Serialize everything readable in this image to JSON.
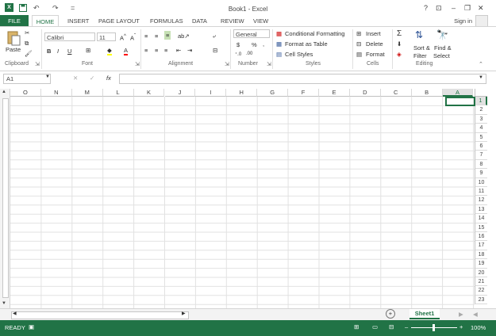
{
  "window": {
    "title": "Book1 - Excel"
  },
  "quick_access": {
    "undo": "↶",
    "redo": "↷",
    "customize": "="
  },
  "window_controls": {
    "help": "?",
    "ribbon_opts": "⊡",
    "minimize": "–",
    "restore": "❐",
    "close": "✕"
  },
  "tabs": [
    "FILE",
    "HOME",
    "INSERT",
    "PAGE LAYOUT",
    "FORMULAS",
    "DATA",
    "REVIEW",
    "VIEW"
  ],
  "account": {
    "signin": "Sign in"
  },
  "ribbon": {
    "clipboard": {
      "paste": "Paste",
      "label": "Clipboard"
    },
    "font": {
      "name": "Calibri",
      "size": "11",
      "label": "Font",
      "bold": "B",
      "italic": "I",
      "underline": "U"
    },
    "alignment": {
      "label": "Alignment"
    },
    "number": {
      "format": "General",
      "currency": "$",
      "percent": "%",
      "comma": ",",
      "label": "Number"
    },
    "styles": {
      "conditional": "Conditional Formatting",
      "table": "Format as Table",
      "cell_styles": "Cell Styles",
      "label": "Styles"
    },
    "cells": {
      "insert": "Insert",
      "delete": "Delete",
      "format": "Format",
      "label": "Cells"
    },
    "editing": {
      "sort": "Sort &",
      "sort2": "Filter",
      "find": "Find &",
      "find2": "Select",
      "label": "Editing"
    }
  },
  "formula_bar": {
    "name_box": "A1",
    "fx": "fx",
    "cancel": "✕",
    "enter": "✓",
    "value": ""
  },
  "columns": [
    "O",
    "N",
    "M",
    "L",
    "K",
    "J",
    "I",
    "H",
    "G",
    "F",
    "E",
    "D",
    "C",
    "B",
    "A"
  ],
  "rows": [
    "1",
    "2",
    "3",
    "4",
    "5",
    "6",
    "7",
    "8",
    "9",
    "10",
    "11",
    "12",
    "13",
    "14",
    "15",
    "16",
    "17",
    "18",
    "19",
    "20",
    "21",
    "22",
    "23"
  ],
  "sheets": {
    "active": "Sheet1",
    "add": "+"
  },
  "status": {
    "mode": "READY",
    "zoom": "100%",
    "zoom_minus": "–",
    "zoom_plus": "+"
  }
}
